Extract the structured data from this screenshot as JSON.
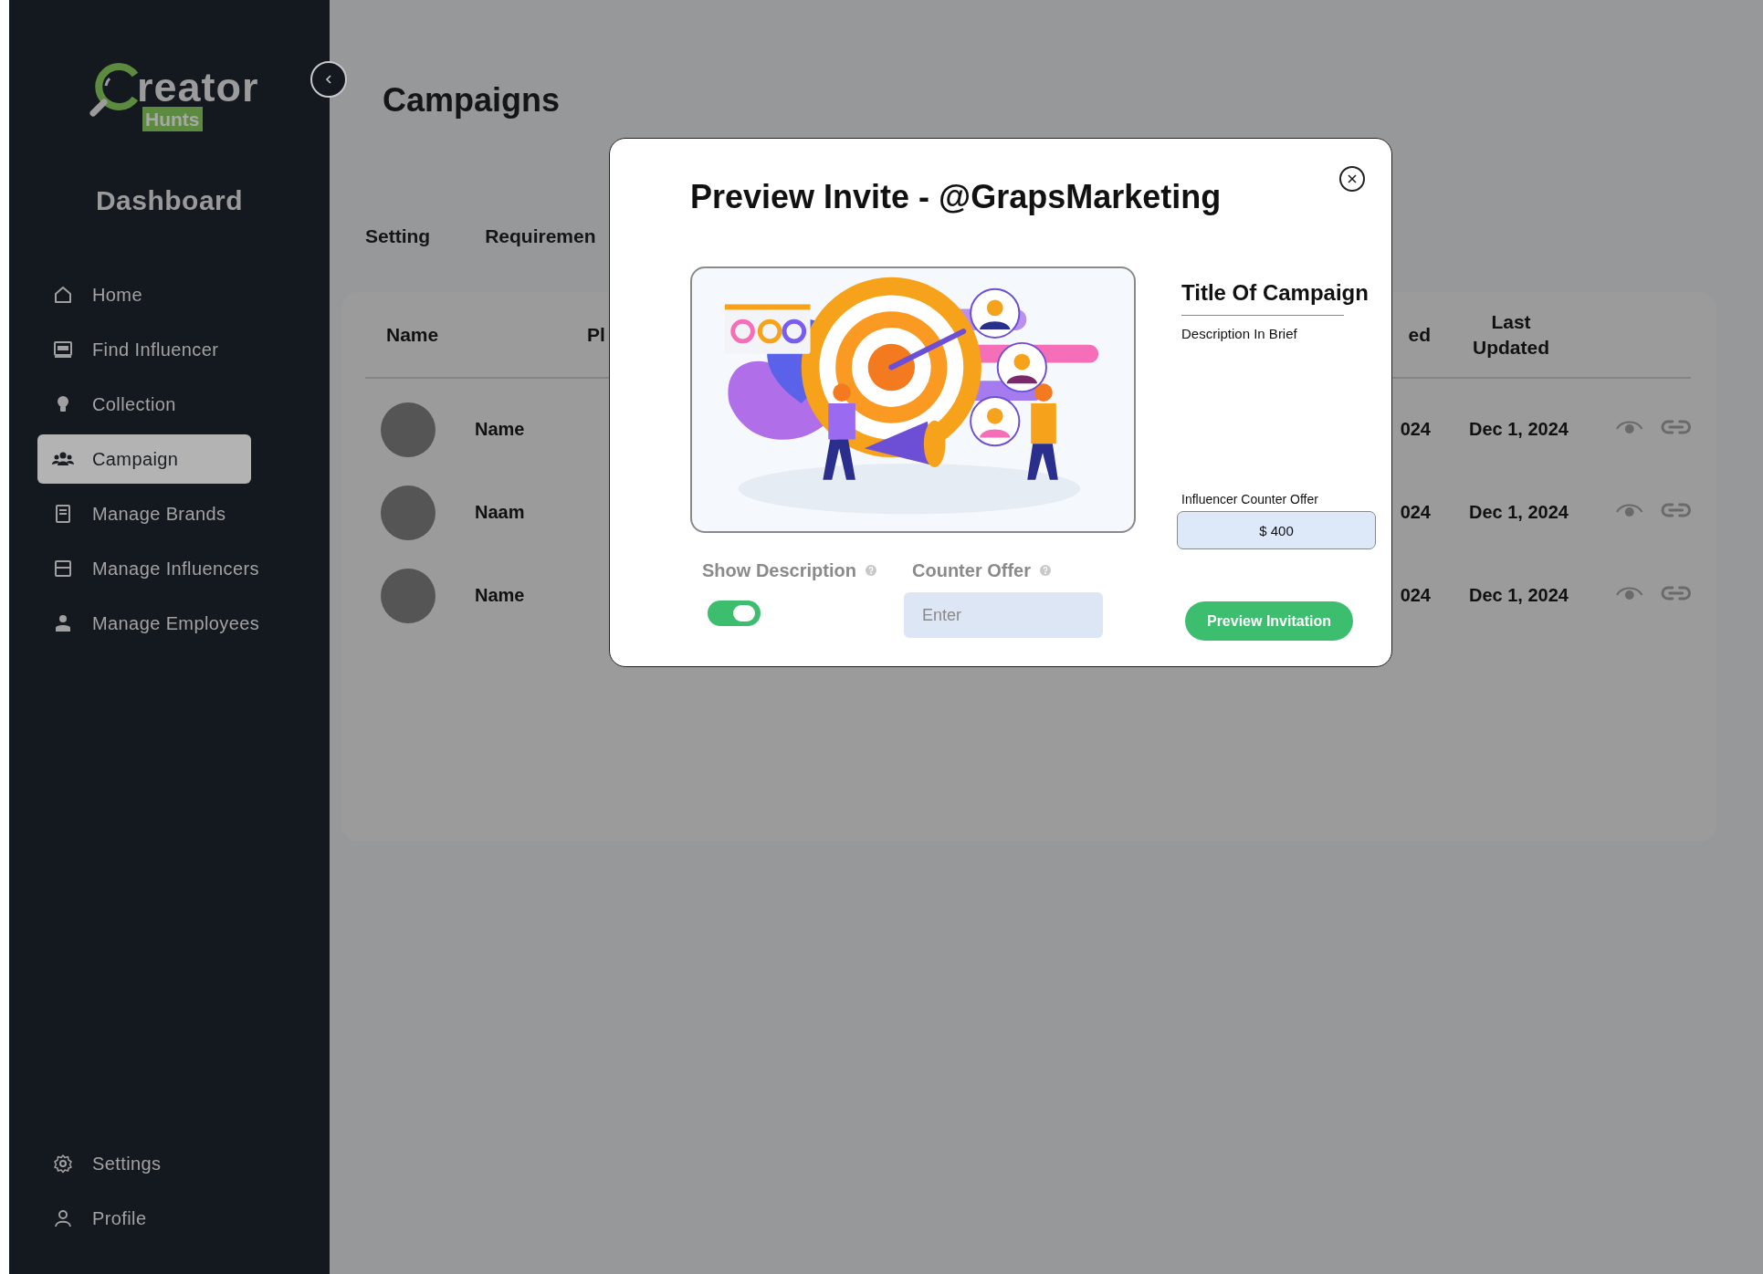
{
  "sidebar": {
    "logo": {
      "wordmark": "reator",
      "tag": "Hunts"
    },
    "heading": "Dashboard",
    "items": [
      {
        "label": "Home",
        "selected": false
      },
      {
        "label": "Find Influencer",
        "selected": false
      },
      {
        "label": "Collection",
        "selected": false
      },
      {
        "label": "Campaign",
        "selected": true
      },
      {
        "label": "Manage Brands",
        "selected": false
      },
      {
        "label": "Manage Influencers",
        "selected": false
      },
      {
        "label": "Manage Employees",
        "selected": false
      }
    ],
    "footer_items": [
      {
        "label": "Settings",
        "selected": false
      },
      {
        "label": "Profile",
        "selected": false
      }
    ]
  },
  "page": {
    "title": "Campaigns",
    "tabs": [
      {
        "label": "Setting",
        "selected": false
      },
      {
        "label": "Requiremen",
        "selected": false
      }
    ]
  },
  "table": {
    "columns": [
      {
        "label": "Name"
      },
      {
        "label": "Pl"
      },
      {
        "label": "ed"
      },
      {
        "label": "Last Updated"
      }
    ],
    "rows": [
      {
        "name": "Name",
        "column_3": "024",
        "last_updated": "Dec 1, 2024"
      },
      {
        "name": "Naam",
        "column_3": "024",
        "last_updated": "Dec 1, 2024"
      },
      {
        "name": "Name",
        "column_3": "024",
        "last_updated": "Dec 1, 2024"
      }
    ]
  },
  "modal": {
    "title": "Preview Invite - @GrapsMarketing",
    "campaign_title": "Title Of Campaign",
    "description": "Description In Brief",
    "counter_offer_label": "Influencer Counter Offer",
    "counter_offer_value": "$ 400",
    "show_description": {
      "label": "Show Description",
      "on": true
    },
    "counter_offer": {
      "label": "Counter Offer",
      "placeholder": "Enter"
    },
    "button": "Preview Invitation"
  }
}
